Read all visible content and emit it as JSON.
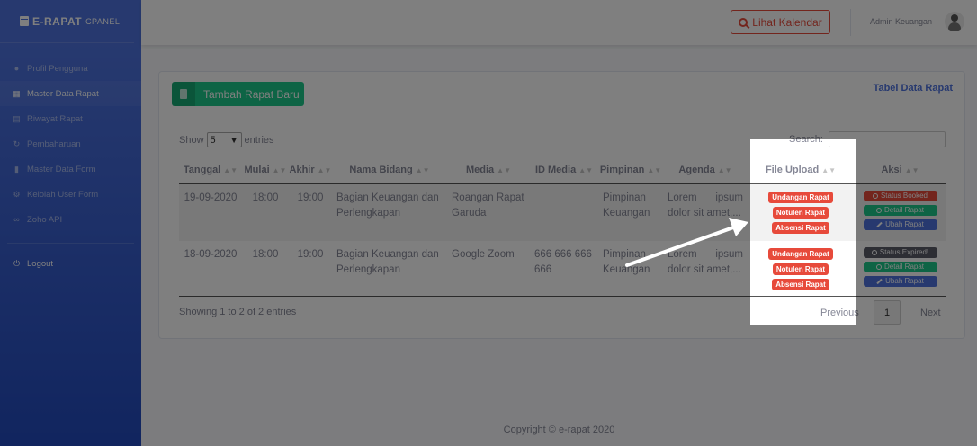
{
  "brand": {
    "name": "E-RAPAT",
    "sub": "CPANEL"
  },
  "sidebar": {
    "items": [
      {
        "label": "Profil Pengguna"
      },
      {
        "label": "Master Data Rapat"
      },
      {
        "label": "Riwayat Rapat"
      },
      {
        "label": "Pembaharuan"
      },
      {
        "label": "Master Data Form"
      },
      {
        "label": "Kelolah User Form"
      },
      {
        "label": "Zoho API"
      }
    ],
    "logout": "Logout"
  },
  "topbar": {
    "kalendar_label": "Lihat Kalendar",
    "user_name": "Admin Keuangan"
  },
  "card": {
    "add_button": "Tambah Rapat Baru",
    "title": "Tabel Data Rapat",
    "show_label": "Show",
    "entries_label": "entries",
    "entries_value": "5",
    "search_label": "Search:"
  },
  "table": {
    "headers": [
      "Tanggal",
      "Mulai",
      "Akhir",
      "Nama Bidang",
      "Media",
      "ID Media",
      "Pimpinan",
      "Agenda",
      "File Upload",
      "Aksi"
    ],
    "rows": [
      {
        "tanggal": "19-09-2020",
        "mulai": "18:00",
        "akhir": "19:00",
        "bidang": "Bagian Keuangan dan Perlengkapan",
        "media": "Roangan Rapat Garuda",
        "id_media": "",
        "pimpinan": "Pimpinan Keuangan",
        "agenda": "Lorem ipsum dolor sit amet,...",
        "files": [
          "Undangan Rapat",
          "Notulen Rapat",
          "Absensi Rapat"
        ],
        "status": "Status Booked",
        "detail": "Detail Rapat",
        "ubah": "Ubah Rapat"
      },
      {
        "tanggal": "18-09-2020",
        "mulai": "18:00",
        "akhir": "19:00",
        "bidang": "Bagian Keuangan dan Perlengkapan",
        "media": "Google Zoom",
        "id_media": "666 666 666 666",
        "pimpinan": "Pimpinan Keuangan",
        "agenda": "Lorem ipsum dolor sit amet,...",
        "files": [
          "Undangan Rapat",
          "Notulen Rapat",
          "Absensi Rapat"
        ],
        "status": "Status Expired!",
        "detail": "Detail Rapat",
        "ubah": "Ubah Rapat"
      }
    ]
  },
  "info": "Showing 1 to 2 of 2 entries",
  "pagination": {
    "prev": "Previous",
    "page": "1",
    "next": "Next"
  },
  "footer": "Copyright © e-rapat 2020",
  "colors": {
    "primary": "#4e73df",
    "success": "#1cc88a",
    "danger": "#e74a3b",
    "dark": "#5a5c69"
  }
}
